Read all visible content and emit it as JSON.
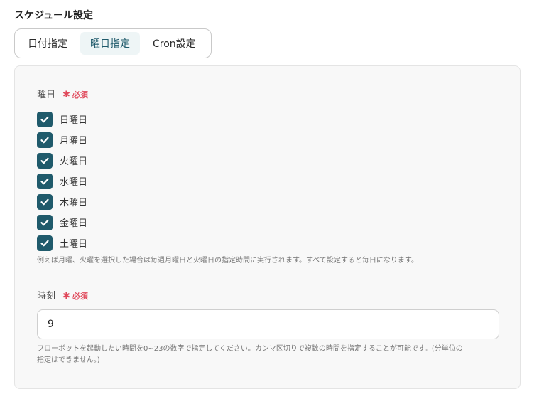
{
  "section_title": "スケジュール設定",
  "tabs": [
    {
      "label": "日付指定",
      "active": false
    },
    {
      "label": "曜日指定",
      "active": true
    },
    {
      "label": "Cron設定",
      "active": false
    }
  ],
  "weekday_field": {
    "label": "曜日",
    "required_label": "必須",
    "days": [
      {
        "label": "日曜日",
        "checked": true
      },
      {
        "label": "月曜日",
        "checked": true
      },
      {
        "label": "火曜日",
        "checked": true
      },
      {
        "label": "水曜日",
        "checked": true
      },
      {
        "label": "木曜日",
        "checked": true
      },
      {
        "label": "金曜日",
        "checked": true
      },
      {
        "label": "土曜日",
        "checked": true
      }
    ],
    "help": "例えば月曜、火曜を選択した場合は毎週月曜日と火曜日の指定時間に実行されます。すべて設定すると毎日になります。"
  },
  "time_field": {
    "label": "時刻",
    "required_label": "必須",
    "value": "9",
    "help_line1": "フローボットを起動したい時間を0~23の数字で指定してください。カンマ区切りで複数の時間を指定することが可能です。(分単位の",
    "help_line2": "指定はできません。)"
  },
  "colors": {
    "accent": "#1f5a6b",
    "required": "#e0485a",
    "panel_bg": "#f8f8f8"
  }
}
